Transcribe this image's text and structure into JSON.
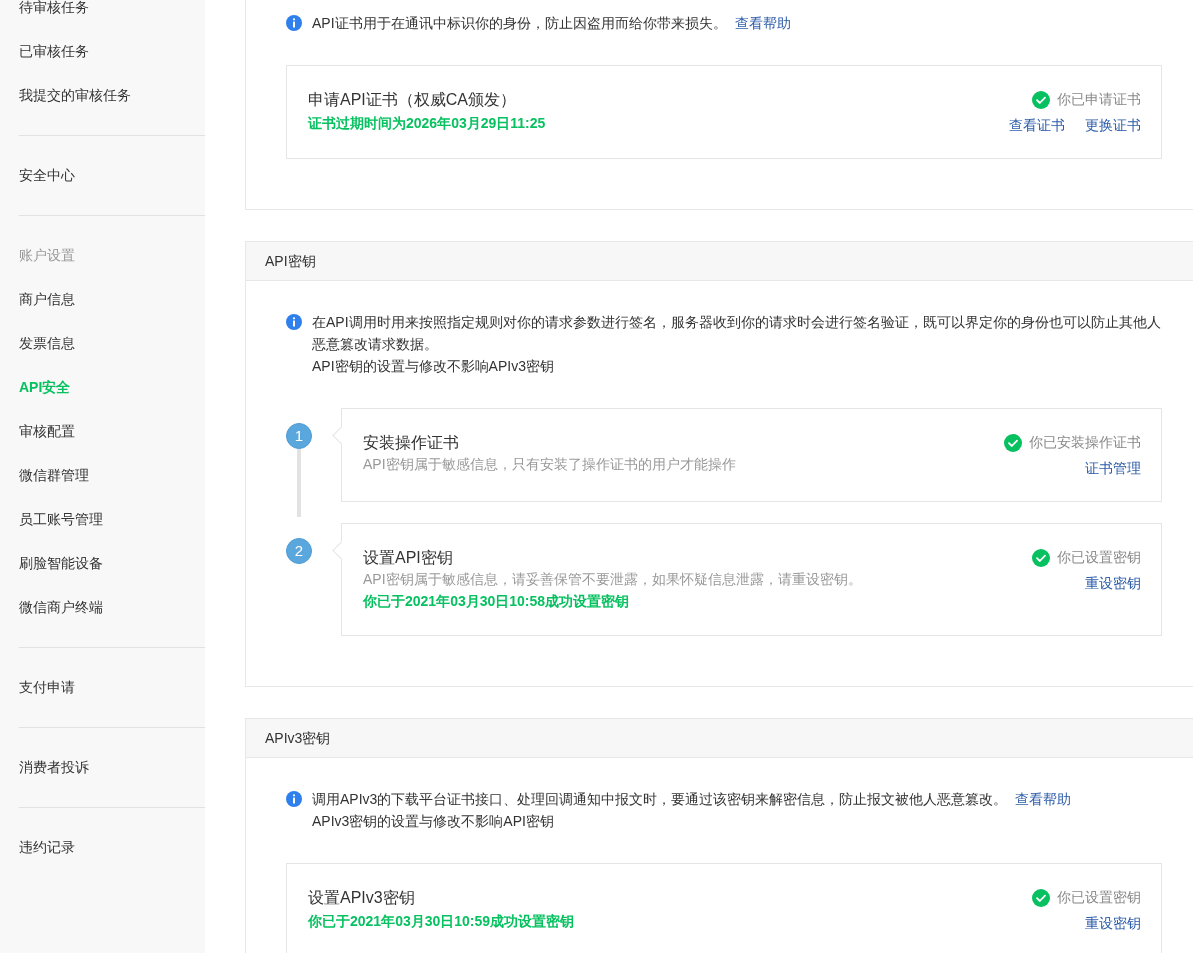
{
  "sidebar": {
    "groups": [
      {
        "items": [
          {
            "label": "待审核任务",
            "selected": false
          },
          {
            "label": "已审核任务",
            "selected": false
          },
          {
            "label": "我提交的审核任务",
            "selected": false
          }
        ]
      },
      {
        "items": [
          {
            "label": "安全中心",
            "selected": false
          }
        ]
      },
      {
        "heading": "账户设置",
        "items": [
          {
            "label": "商户信息",
            "selected": false
          },
          {
            "label": "发票信息",
            "selected": false
          },
          {
            "label": "API安全",
            "selected": true
          },
          {
            "label": "审核配置",
            "selected": false
          },
          {
            "label": "微信群管理",
            "selected": false
          },
          {
            "label": "员工账号管理",
            "selected": false
          },
          {
            "label": "刷脸智能设备",
            "selected": false
          },
          {
            "label": "微信商户终端",
            "selected": false
          }
        ]
      },
      {
        "items": [
          {
            "label": "支付申请",
            "selected": false
          }
        ]
      },
      {
        "items": [
          {
            "label": "消费者投诉",
            "selected": false
          }
        ]
      },
      {
        "items": [
          {
            "label": "违约记录",
            "selected": false
          }
        ]
      }
    ]
  },
  "sections": [
    {
      "info": {
        "lines": [
          "API证书用于在通讯中标识你的身份，防止因盗用而给你带来损失。"
        ],
        "link": "查看帮助"
      },
      "cards": [
        {
          "kind": "plain",
          "title": "申请API证书（权威CA颁发）",
          "success_note": "证书过期时间为2026年03月29日11:25",
          "status": "你已申请证书",
          "done": true,
          "actions": [
            "查看证书",
            "更换证书"
          ]
        }
      ]
    },
    {
      "title": "API密钥",
      "info": {
        "lines": [
          "在API调用时用来按照指定规则对你的请求参数进行签名，服务器收到你的请求时会进行签名验证，既可以界定你的身份也可以防止其他人",
          "恶意篡改请求数据。",
          "API密钥的设置与修改不影响APIv3密钥"
        ]
      },
      "cards": [
        {
          "kind": "step",
          "step": "1",
          "title": "安装操作证书",
          "description": "API密钥属于敏感信息，只有安装了操作证书的用户才能操作",
          "status": "你已安装操作证书",
          "done": true,
          "actions": [
            "证书管理"
          ]
        },
        {
          "kind": "step",
          "step": "2",
          "title": "设置API密钥",
          "description": "API密钥属于敏感信息，请妥善保管不要泄露，如果怀疑信息泄露，请重设密钥。",
          "success_note": "你已于2021年03月30日10:58成功设置密钥",
          "status": "你已设置密钥",
          "done": true,
          "actions": [
            "重设密钥"
          ]
        }
      ]
    },
    {
      "title": "APIv3密钥",
      "info": {
        "lines": [
          "调用APIv3的下载平台证书接口、处理回调通知中报文时，要通过该密钥来解密信息，防止报文被他人恶意篡改。",
          "APIv3密钥的设置与修改不影响API密钥"
        ],
        "link": "查看帮助"
      },
      "cards": [
        {
          "kind": "plain",
          "title": "设置APIv3密钥",
          "success_note": "你已于2021年03月30日10:59成功设置密钥",
          "status": "你已设置密钥",
          "done": true,
          "actions": [
            "重设密钥"
          ]
        }
      ]
    }
  ]
}
